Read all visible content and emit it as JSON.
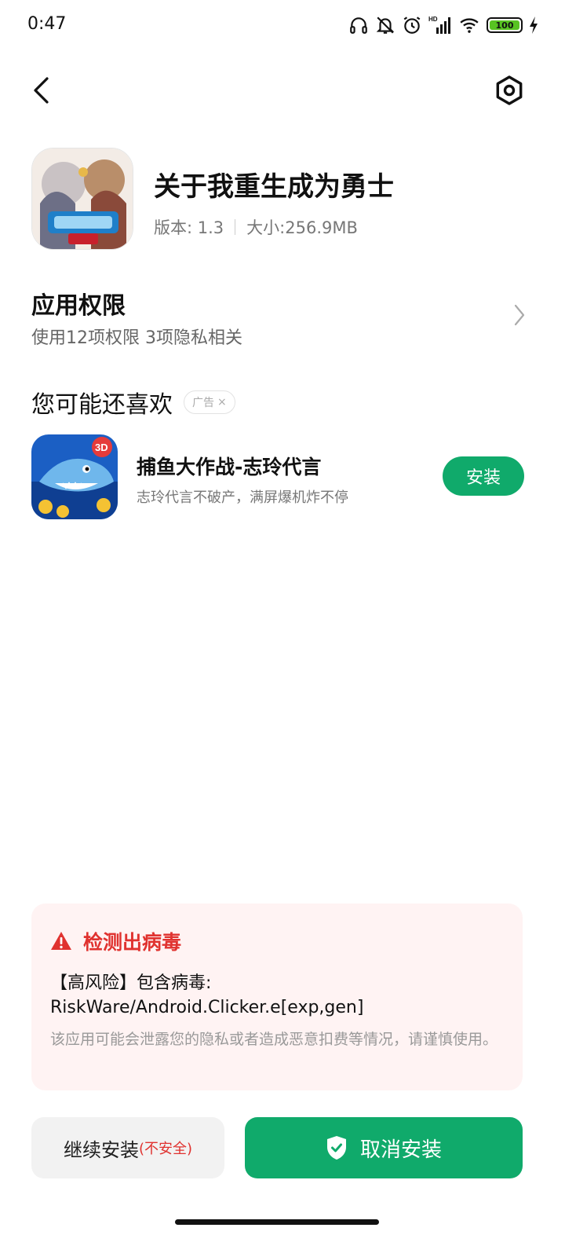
{
  "status_bar": {
    "time": "0:47",
    "battery": "100",
    "network_badge": "HD"
  },
  "app": {
    "title": "关于我重生成为勇士",
    "version": "版本: 1.3",
    "size": "大小:256.9MB"
  },
  "permissions": {
    "title": "应用权限",
    "subtitle": "使用12项权限 3项隐私相关"
  },
  "recommend": {
    "title": "您可能还喜欢",
    "ad_label": "广告",
    "ad_close": "×",
    "item": {
      "name": "捕鱼大作战-志玲代言",
      "desc": "志玲代言不破产，满屏爆机炸不停",
      "button": "安装",
      "icon_badge": "3D"
    }
  },
  "virus": {
    "title": "检测出病毒",
    "detail": "【高风险】包含病毒: RiskWare/Android.Clicker.e[exp,gen]",
    "note": "该应用可能会泄露您的隐私或者造成恶意扣费等情况，请谨慎使用。"
  },
  "actions": {
    "continue_label": "继续安装",
    "continue_warning": "(不安全)",
    "cancel_label": "取消安装"
  },
  "colors": {
    "accent_green": "#10aa6b",
    "danger_red": "#e0322f",
    "battery_green": "#58c322"
  },
  "icons": [
    "headphones-icon",
    "bell-off-icon",
    "alarm-icon",
    "signal-icon",
    "wifi-icon",
    "battery-icon",
    "charging-icon",
    "back-icon",
    "settings-icon",
    "chevron-right-icon",
    "warning-icon",
    "shield-check-icon"
  ]
}
